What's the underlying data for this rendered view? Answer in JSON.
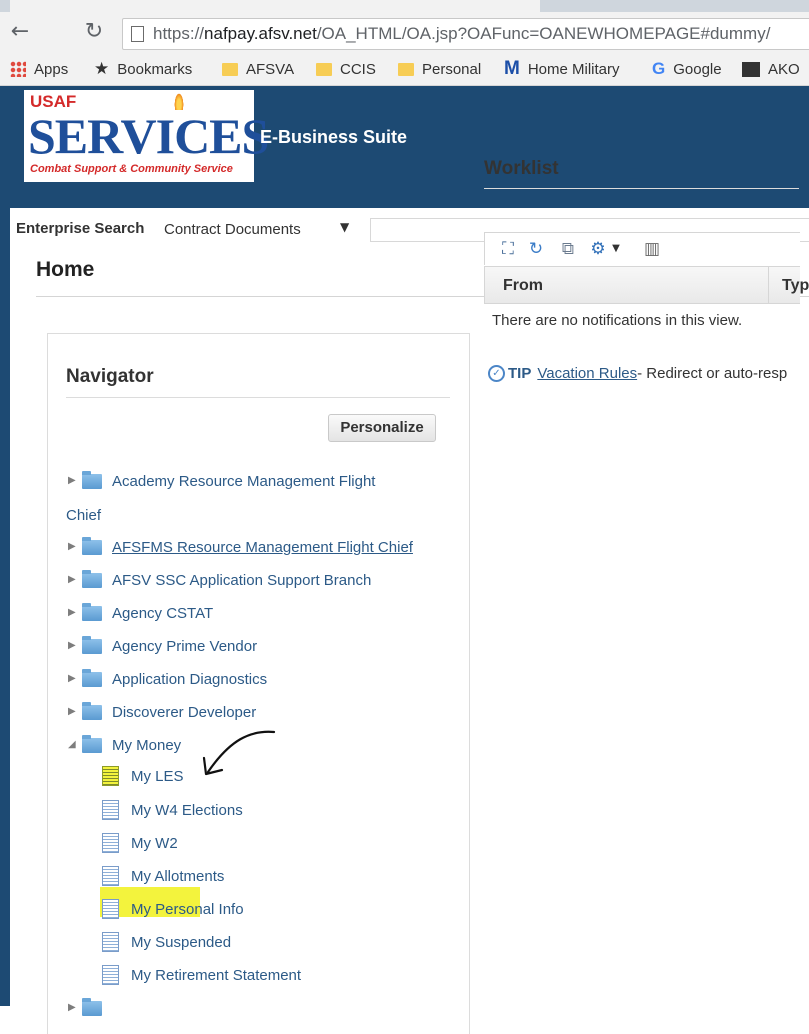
{
  "browser": {
    "url_prefix": "https://",
    "url_host": "nafpay.afsv.net",
    "url_path": "/OA_HTML/OA.jsp?OAFunc=OANEWHOMEPAGE#dummy/",
    "bookmarks": [
      "Apps",
      "Bookmarks",
      "AFSVA",
      "CCIS",
      "Personal",
      "Home Military",
      "Google",
      "AKO"
    ]
  },
  "brand": {
    "logo_top": "USAF",
    "logo_main": "SERVICES",
    "logo_tagline": "Combat Support & Community Service",
    "suite_title": "E-Business Suite"
  },
  "search": {
    "label": "Enterprise Search",
    "selected": "Contract Documents"
  },
  "page_title": "Home",
  "navigator": {
    "heading": "Navigator",
    "personalize_label": "Personalize",
    "folders": [
      "Academy Resource Management Flight",
      "AFSFMS Resource Management Flight Chief",
      "AFSV SSC Application Support Branch",
      "Agency CSTAT",
      "Agency Prime Vendor",
      "Application Diagnostics",
      "Discoverer Developer",
      "My Money"
    ],
    "folder0_wrap": "Chief",
    "documents": [
      "My LES",
      "My W4 Elections",
      "My W2",
      "My Allotments",
      "My Personal Info",
      "My Suspended",
      "My Retirement Statement"
    ]
  },
  "worklist": {
    "heading": "Worklist",
    "columns": [
      "From",
      "Typ"
    ],
    "empty_message": "There are no notifications in this view.",
    "tip_label": "TIP",
    "tip_link": "Vacation Rules",
    "tip_text": " - Redirect or auto-resp"
  },
  "colors": {
    "brand_bar": "#1d4a73",
    "link": "#2c5a87",
    "highlight": "#f3f33d"
  }
}
